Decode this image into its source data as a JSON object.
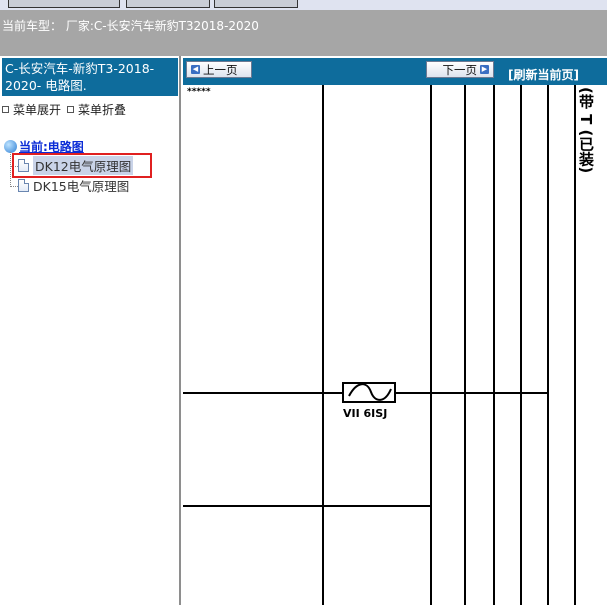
{
  "header": {
    "car_model": "当前车型： 厂家:C-长安汽车新豹T32018-2020"
  },
  "sidebar": {
    "vehicle_title": "C-长安汽车-新豹T3-2018-2020- 电路图.",
    "expand_label": "菜单展开",
    "collapse_label": "菜单折叠",
    "tree_root": "当前:电路图",
    "items": [
      {
        "label": "DK12电气原理图",
        "selected": true
      },
      {
        "label": "DK15电气原理图",
        "selected": false
      }
    ]
  },
  "nav": {
    "prev_label": "上一页",
    "next_label": "下一页",
    "refresh_label": "[刷新当前页]"
  },
  "diagram": {
    "top_label": "*****",
    "fuse_text": "VII 6ISJ",
    "right_label": "(带 T (已装)"
  },
  "colors": {
    "title_bar": "#0e6c9c",
    "header_band": "#a6a6a6",
    "highlight": "#e02020",
    "root_link": "#0a2bd6"
  }
}
